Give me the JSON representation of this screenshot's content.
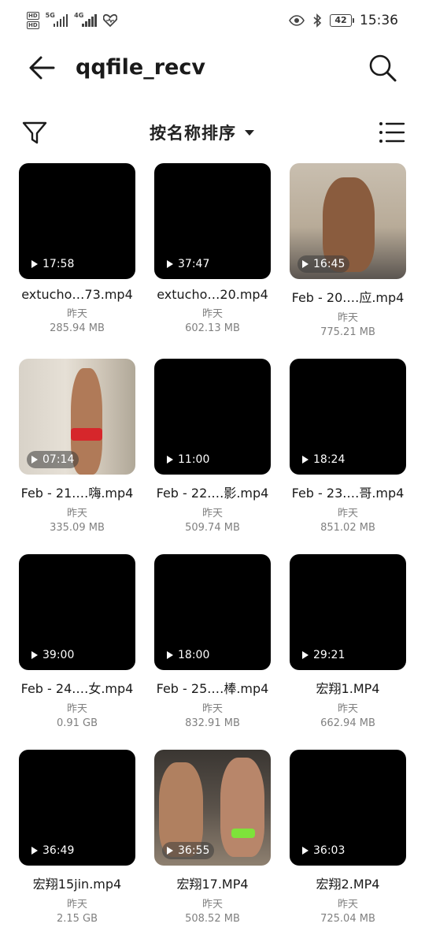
{
  "status_bar": {
    "hd1": "HD",
    "hd2": "HD",
    "net1": "5G",
    "net2": "4G",
    "battery": "42",
    "time": "15:36"
  },
  "header": {
    "title": "qqfile_recv"
  },
  "toolbar": {
    "sort_label": "按名称排序"
  },
  "files": [
    {
      "duration": "17:58",
      "name": "extucho…73.mp4",
      "date": "昨天",
      "size": "285.94 MB",
      "thumb": "black"
    },
    {
      "duration": "37:47",
      "name": "extucho…20.mp4",
      "date": "昨天",
      "size": "602.13 MB",
      "thumb": "black"
    },
    {
      "duration": "16:45",
      "name": "Feb - 20.…应.mp4",
      "date": "昨天",
      "size": "775.21 MB",
      "thumb": "photo"
    },
    {
      "duration": "07:14",
      "name": "Feb - 21.…嗨.mp4",
      "date": "昨天",
      "size": "335.09 MB",
      "thumb": "photo2"
    },
    {
      "duration": "11:00",
      "name": "Feb - 22.…影.mp4",
      "date": "昨天",
      "size": "509.74 MB",
      "thumb": "black"
    },
    {
      "duration": "18:24",
      "name": "Feb - 23.…哥.mp4",
      "date": "昨天",
      "size": "851.02 MB",
      "thumb": "black"
    },
    {
      "duration": "39:00",
      "name": "Feb - 24.…女.mp4",
      "date": "昨天",
      "size": "0.91 GB",
      "thumb": "black"
    },
    {
      "duration": "18:00",
      "name": "Feb - 25.…棒.mp4",
      "date": "昨天",
      "size": "832.91 MB",
      "thumb": "black"
    },
    {
      "duration": "29:21",
      "name": "宏翔1.MP4",
      "date": "昨天",
      "size": "662.94 MB",
      "thumb": "black"
    },
    {
      "duration": "36:49",
      "name": "宏翔15jin.mp4",
      "date": "昨天",
      "size": "2.15 GB",
      "thumb": "black"
    },
    {
      "duration": "36:55",
      "name": "宏翔17.MP4",
      "date": "昨天",
      "size": "508.52 MB",
      "thumb": "photo3"
    },
    {
      "duration": "36:03",
      "name": "宏翔2.MP4",
      "date": "昨天",
      "size": "725.04 MB",
      "thumb": "black"
    }
  ],
  "icons": {
    "back": "back-arrow-icon",
    "search": "search-icon",
    "filter": "filter-icon",
    "sort_caret": "caret-down-icon",
    "view": "list-view-icon",
    "play": "play-icon",
    "eye": "eye-icon",
    "bluetooth": "bluetooth-icon",
    "heart": "heart-icon"
  },
  "colors": {
    "background": "#ffffff",
    "text_primary": "#1a1a1a",
    "text_secondary": "#808080",
    "thumbnail_bg": "#000000"
  }
}
